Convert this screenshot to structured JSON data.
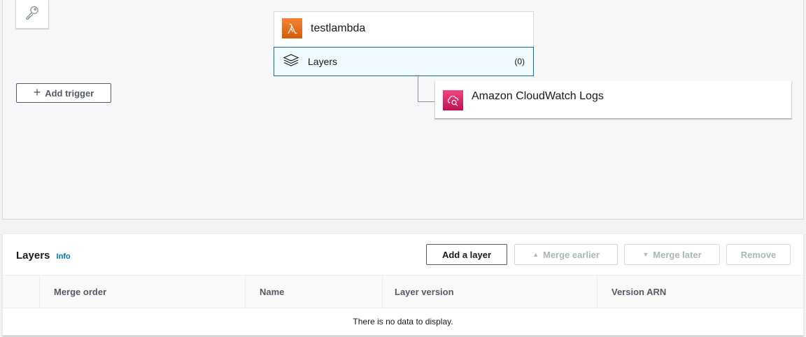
{
  "designer": {
    "add_trigger_label": "Add trigger",
    "function": {
      "name": "testlambda",
      "icon": "lambda-icon",
      "layers_label": "Layers",
      "layers_count": "(0)"
    },
    "destination": {
      "name": "Amazon CloudWatch Logs",
      "icon": "cloudwatch-icon"
    }
  },
  "layers_panel": {
    "title": "Layers",
    "info_label": "Info",
    "buttons": {
      "add_layer": "Add a layer",
      "merge_earlier": "Merge earlier",
      "merge_later": "Merge later",
      "remove": "Remove"
    },
    "columns": [
      "Merge order",
      "Name",
      "Layer version",
      "Version ARN"
    ],
    "empty_message": "There is no data to display."
  },
  "colors": {
    "accent": "#0073bb",
    "lambda_orange": "#e7700d",
    "cloudwatch_pink": "#e7157b"
  }
}
